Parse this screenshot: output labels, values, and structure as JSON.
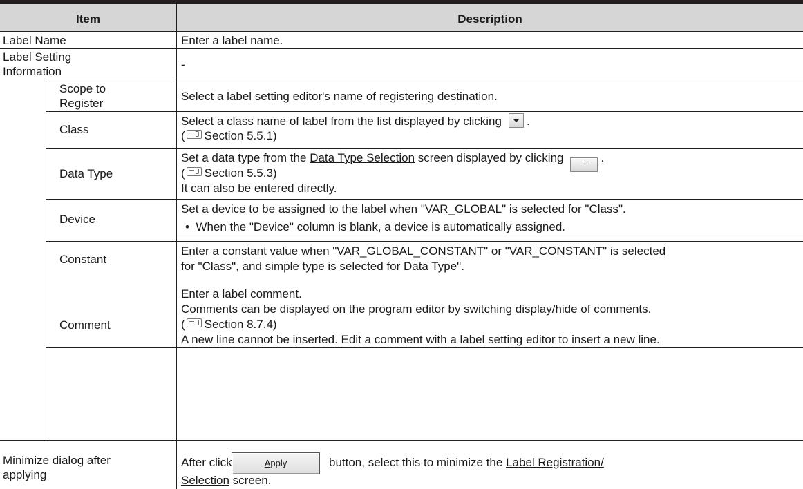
{
  "header": {
    "item": "Item",
    "description": "Description"
  },
  "rows": {
    "label_name": {
      "item": "Label Name",
      "desc": "Enter a label name."
    },
    "label_setting": {
      "item": "Label Setting Information",
      "desc": "-"
    },
    "scope": {
      "item": "Scope to Register",
      "desc": "Select a label setting editor's name of registering destination."
    },
    "class": {
      "item": "Class",
      "desc1": "Select a class name of label from the list displayed by clicking",
      "desc1_end": ".",
      "ref": "Section 5.5.1"
    },
    "data_type": {
      "item": "Data Type",
      "desc1a": "Set a data type from the",
      "desc1_link": "Data Type Selection",
      "desc1b": "screen displayed by clicking",
      "dots_label": "...",
      "desc1_end": ".",
      "ref": "Section 5.5.3",
      "desc3": "It can also be entered directly."
    },
    "device": {
      "item": "Device",
      "desc1": "Set a device to be assigned to the label when \"VAR_GLOBAL\" is selected for \"Class\".",
      "bullet": "•",
      "desc2": "When the \"Device\" column is blank, a device is automatically assigned."
    },
    "constant": {
      "item": "Constant",
      "desc1": "Enter a constant value when \"VAR_GLOBAL_CONSTANT\" or \"VAR_CONSTANT\" is selected",
      "desc2": "for \"Class\", and simple type is selected for Data Type\"."
    },
    "comment": {
      "item": "Comment",
      "desc1": "Enter a label comment.",
      "desc2": "Comments can be displayed on the program editor by switching display/hide of comments.",
      "ref": "Section 8.7.4",
      "desc4": "A new line cannot be inserted. Edit a comment with a label setting editor to insert a new line."
    },
    "minimize": {
      "item": "Minimize dialog after applying",
      "desc1a": "After clicking the",
      "apply_first": "A",
      "apply_rest": "pply",
      "desc1b": "button, select this to minimize the",
      "link1": "Label Registration/",
      "link2": "Selection",
      "desc2": "screen."
    }
  },
  "ref_paren_open": "(",
  "ref_paren_close": ")"
}
